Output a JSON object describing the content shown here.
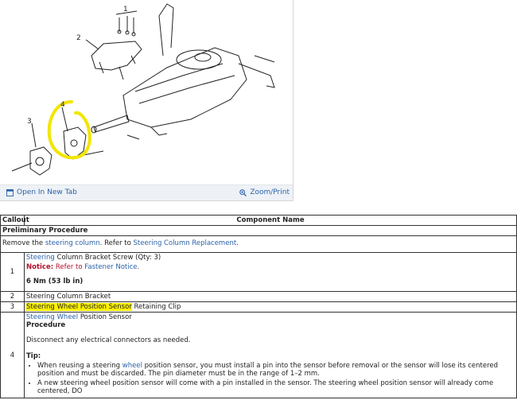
{
  "figure": {
    "callouts": [
      "1",
      "2",
      "3",
      "4"
    ],
    "open_label": "Open In New Tab",
    "zoom_label": "Zoom/Print"
  },
  "table": {
    "header_callout": "Callout",
    "header_component": "Component Name",
    "preliminary_title": "Preliminary Procedure",
    "preliminary_text": {
      "pre": "Remove the ",
      "link1": "steering column",
      "mid": ". Refer to ",
      "link2": "Steering Column Replacement",
      "post": "."
    },
    "rows": [
      {
        "num": "1",
        "name_link": "Steering",
        "name_rest": " Column Bracket Screw (Qty: 3)",
        "notice_label": "Notice:",
        "notice_pre": " Refer to ",
        "notice_link": "Fastener Notice",
        "notice_post": ".",
        "torque": "6 Nm (53 lb in)"
      },
      {
        "num": "2",
        "name": "Steering Column Bracket"
      },
      {
        "num": "3",
        "name_hl": "Steering Wheel Position Sensor",
        "name_rest": " Retaining Clip"
      },
      {
        "num": "4",
        "name_link1": "Steering",
        "name_link2": "Wheel",
        "name_rest": " Position Sensor",
        "procedure_title": "Procedure",
        "procedure_text": "Disconnect any electrical connectors as needed.",
        "tip_title": "Tip:",
        "tip_item1_pre": "When reusing a steering ",
        "tip_item1_link": "wheel",
        "tip_item1_post": " position sensor, you must install a pin into the sensor before removal or the sensor will lose its centered position and must be discarded. The pin diameter must be in the range of 1–2 mm.",
        "tip_item2": "A new steering wheel position sensor will come with a pin installed in the sensor. The steering wheel position sensor will already come centered, DO"
      }
    ]
  },
  "colors": {
    "link": "#2a62a8",
    "notice": "#b3102c",
    "highlight": "#fff200"
  }
}
